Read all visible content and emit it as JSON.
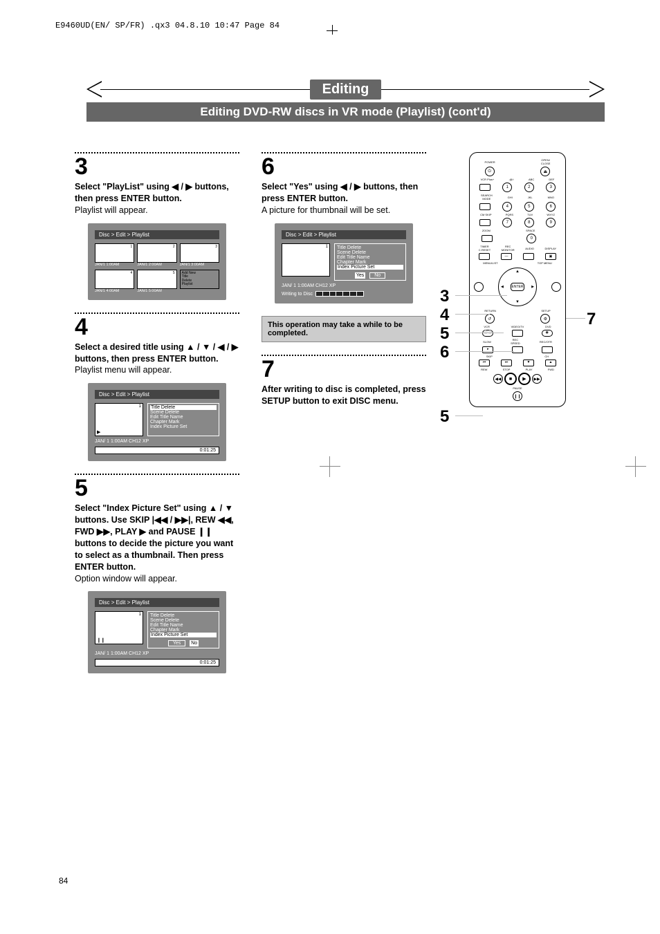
{
  "header_line": "E9460UD(EN/ SP/FR)  .qx3  04.8.10  10:47  Page 84",
  "banner_title": "Editing",
  "subtitle": "Editing DVD-RW discs in VR mode (Playlist) (cont'd)",
  "page_number": "84",
  "screen_breadcrumb": "Disc > Edit > Playlist",
  "menu_items": {
    "title_delete": "Title Delete",
    "scene_delete": "Scene Delete",
    "edit_title_name": "Edit Title Name",
    "chapter_mark": "Chapter Mark",
    "index_picture_set": "Index Picture Set"
  },
  "yes": "Yes",
  "no": "No",
  "detail_info": "JAN/ 1  1:00AM  CH12     XP",
  "detail_time": "0:01:25",
  "writing": "Writing to Disc",
  "thumbs_s3": [
    {
      "n": "1",
      "label": "JAN/1  1:00AM"
    },
    {
      "n": "2",
      "label": "JAN/1  2:00AM"
    },
    {
      "n": "3",
      "label": "JAN/1  3:00AM"
    },
    {
      "n": "4",
      "label": "JAN/1  4:00AM"
    },
    {
      "n": "5",
      "label": "JAN/1  5:00AM"
    }
  ],
  "add_cell_lines": [
    "Add New",
    "Title",
    "Delete",
    "Playlist"
  ],
  "steps": {
    "s3": {
      "num": "3",
      "bold": "Select \"PlayList\" using ◀ / ▶ buttons, then press ENTER button.",
      "plain": "Playlist will appear."
    },
    "s4": {
      "num": "4",
      "bold": "Select a desired title using ▲ / ▼ / ◀ / ▶ buttons, then press ENTER button.",
      "plain": "Playlist menu will appear."
    },
    "s5": {
      "num": "5",
      "bold": "Select \"Index Picture Set\" using ▲ / ▼ buttons. Use SKIP |◀◀ / ▶▶|, REW ◀◀, FWD ▶▶, PLAY ▶ and PAUSE ❙❙ buttons to decide the picture you want to select as a thumbnail. Then press ENTER button.",
      "plain": "Option window will appear."
    },
    "s6": {
      "num": "6",
      "bold": "Select \"Yes\" using ◀ / ▶ buttons, then press ENTER button.",
      "plain": "A picture for thumbnail will be set."
    },
    "s7": {
      "num": "7",
      "bold": "After writing to disc is completed, press SETUP button to exit DISC menu."
    }
  },
  "note": "This operation may take a while to be completed.",
  "remote_labels": {
    "power": "POWER",
    "open": "OPEN/\nCLOSE",
    "vcrplus": "VCR Plus+",
    "search": "SEARCH\nMODE",
    "cmskip": "CM SKIP",
    "zoom": "ZOOM",
    "timer": "TIMER\nC.RESET",
    "rec_mon": "REC\nMONITOR",
    "audio": "AUDIO",
    "display": "DISPLAY",
    "menulist": "MENU/LIST",
    "top_menu": "TOP MENU",
    "return": "RETURN",
    "setup": "SETUP",
    "vcr": "VCR",
    "videotv": "VIDEO/TV",
    "dvd": "DVD",
    "slow": "SLOW",
    "rec_speed": "REC\nSPEED",
    "recotr": "REC/OTR",
    "skip": "SKIP",
    "ch": "CH",
    "rew": "REW",
    "stop": "STOP",
    "play": "PLAY",
    "fwd": "FWD",
    "pause": "PAUSE",
    "enter": "ENTER",
    "abc": "ABC",
    "def": "DEF",
    "ghi": "GHI",
    "jkl": "JKL",
    "mno": "MNO",
    "pqrs": "PQRS",
    "tuv": "TUV",
    "wxyz": "WXYZ",
    "space": "SPACE",
    "sym1": ".@/:",
    "zero": "0"
  },
  "callouts": {
    "c3": "3",
    "c4": "4",
    "c5a": "5",
    "c6": "6",
    "c7": "7",
    "c5b": "5"
  }
}
